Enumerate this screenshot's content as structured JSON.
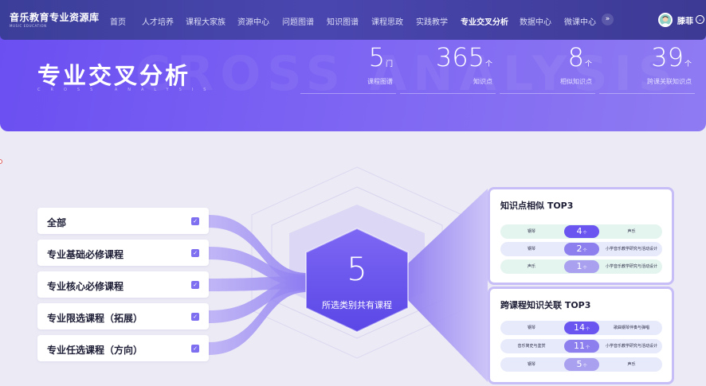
{
  "nav": {
    "brand_title": "音乐教育专业资源库",
    "brand_sub": "MUSIC EDUCATION",
    "items": [
      {
        "label": "首页",
        "active": false
      },
      {
        "label": "人才培养",
        "active": false
      },
      {
        "label": "课程大家族",
        "active": false
      },
      {
        "label": "资源中心",
        "active": false
      },
      {
        "label": "问题图谱",
        "active": false
      },
      {
        "label": "知识图谱",
        "active": false
      },
      {
        "label": "课程思政",
        "active": false
      },
      {
        "label": "实践教学",
        "active": false
      },
      {
        "label": "专业交叉分析",
        "active": true
      },
      {
        "label": "数据中心",
        "active": false
      },
      {
        "label": "微课中心",
        "active": false
      }
    ],
    "more_label": "»",
    "user_name": "滕菲",
    "user_caret": "⌄"
  },
  "hero": {
    "title": "专业交叉分析",
    "subtitle": "CROSS ANALYSIS",
    "stats": [
      {
        "value": "5",
        "unit": "门",
        "label": "课程图谱"
      },
      {
        "value": "365",
        "unit": "个",
        "label": "知识点"
      },
      {
        "value": "8",
        "unit": "个",
        "label": "相似知识点"
      },
      {
        "value": "39",
        "unit": "个",
        "label": "跨课关联知识点"
      }
    ]
  },
  "categories": [
    {
      "label": "全部",
      "checked": true
    },
    {
      "label": "专业基础必修课程",
      "checked": true
    },
    {
      "label": "专业核心必修课程",
      "checked": true
    },
    {
      "label": "专业限选课程（拓展）",
      "checked": true
    },
    {
      "label": "专业任选课程（方向）",
      "checked": true
    }
  ],
  "check_glyph": "✓",
  "center": {
    "count": "5",
    "caption": "所选类别共有课程"
  },
  "similar": {
    "title": "知识点相似 TOP3",
    "rows": [
      {
        "left": "钢琴",
        "count": "4",
        "unit": "个",
        "right": "声乐"
      },
      {
        "left": "钢琴",
        "count": "2",
        "unit": "个",
        "right": "小学音乐教学研究与活动设计"
      },
      {
        "left": "声乐",
        "count": "1",
        "unit": "个",
        "right": "小学音乐教学研究与活动设计"
      }
    ]
  },
  "cross": {
    "title": "跨课程知识关联 TOP3",
    "rows": [
      {
        "left": "钢琴",
        "count": "14",
        "unit": "个",
        "right": "歌曲钢琴伴奏与弹唱"
      },
      {
        "left": "音乐简史与鉴赏",
        "count": "11",
        "unit": "个",
        "right": "小学音乐教学研究与活动设计"
      },
      {
        "left": "钢琴",
        "count": "5",
        "unit": "个",
        "right": "声乐"
      }
    ]
  },
  "colors": {
    "accent": "#6a55f0",
    "hero_start": "#6b4ff1",
    "nav": "#3b3e98",
    "flow_ribbon": "#a294f4",
    "similar_row_bg": "#e4f4ef",
    "cross_row_bg": "#e7eafb"
  }
}
